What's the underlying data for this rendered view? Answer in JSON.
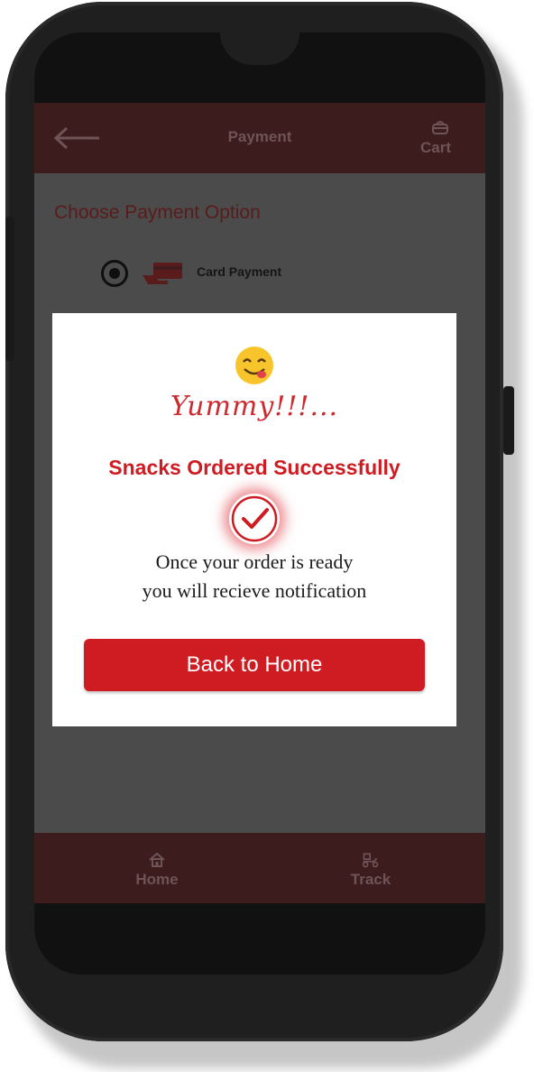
{
  "header": {
    "title": "Payment",
    "cart_label": "Cart"
  },
  "payment": {
    "heading": "Choose Payment Option",
    "option_label": "Card Payment",
    "selected": true
  },
  "modal": {
    "exclamation": "Yummy!!!...",
    "title": "Snacks Ordered Successfully",
    "message_line1": "Once your order is ready",
    "message_line2": "you will recieve notification",
    "button_label": "Back to Home"
  },
  "bottom_nav": {
    "home_label": "Home",
    "track_label": "Track"
  },
  "colors": {
    "brand_red": "#cf1b22",
    "header_dim": "#3c1c1d",
    "overlay": "#4b4b4b"
  }
}
